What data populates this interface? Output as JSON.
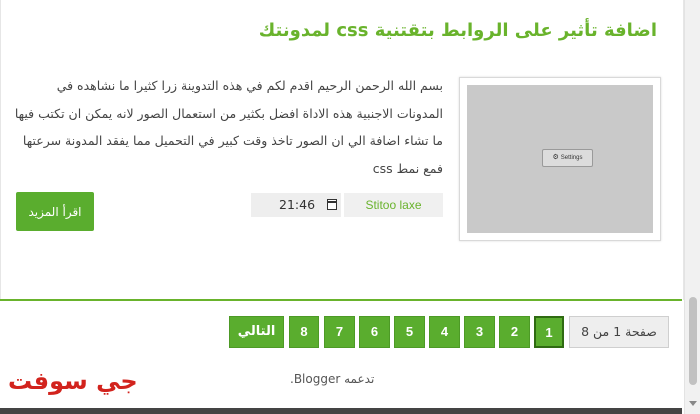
{
  "post": {
    "title": "اضافة تأثير على الروابط بتقتنية css لمدونتك",
    "excerpt": "بسم الله الرحمن الرحيم  اقدم لكم في هذه التدوينة زرا كثيرا ما نشاهده في المدونات الاجنبية هذه الاداة افضل بكثير من استعمال الصور لانه يمكن ان تكتب فيها ما تشاء اضافة الي ان الصور تاخذ وقت كبير في التحميل مما يفقد المدونة سرعتها فمع نمط css",
    "thumbnail_label": "Settings",
    "thumbnail_icon": "gear-icon",
    "time": "21:46",
    "author": "Stitoo laxe",
    "read_more_label": "اقرأ المزيد"
  },
  "pagination": {
    "info": "صفحة 1 من 8",
    "pages": [
      "1",
      "2",
      "3",
      "4",
      "5",
      "6",
      "7",
      "8"
    ],
    "current": "1",
    "next_label": "التالي"
  },
  "footer": {
    "powered_prefix": "تدعمه",
    "powered_link": "Blogger",
    "powered_suffix": "."
  },
  "logo_text": "جي سوفت",
  "colors": {
    "accent": "#69b32c",
    "button": "#5aad2e",
    "logo": "#d2231d"
  }
}
